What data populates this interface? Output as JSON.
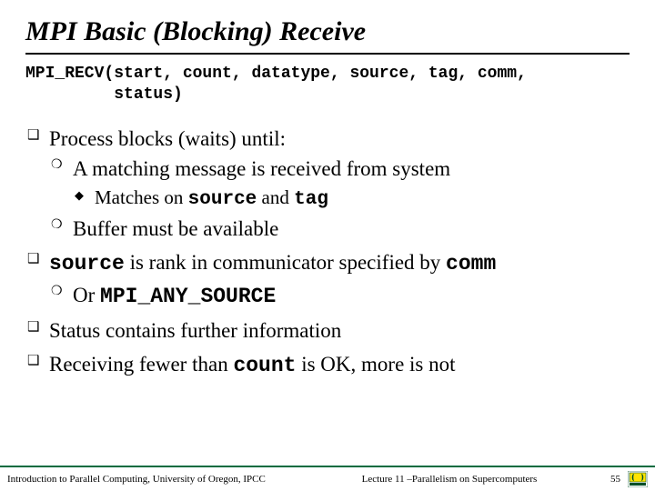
{
  "title": "MPI Basic (Blocking) Receive",
  "signature": "MPI_RECV(start, count, datatype, source, tag, comm,\n         status)",
  "bullets": {
    "b1": "Process blocks (waits) until:",
    "b1a_pre": "A matching message is received from system",
    "b1a1_pre": "Matches on ",
    "b1a1_m1": "source",
    "b1a1_mid": " and ",
    "b1a1_m2": "tag",
    "b1b": "Buffer must be available",
    "b2_m1": "source",
    "b2_mid": " is rank in communicator specified by ",
    "b2_m2": "comm",
    "b2a_pre": "Or ",
    "b2a_m": "MPI_ANY_SOURCE",
    "b3": "Status contains further information",
    "b4_pre": "Receiving fewer than ",
    "b4_m": "count",
    "b4_post": " is OK, more is not"
  },
  "footer": {
    "left": "Introduction to Parallel Computing, University of Oregon, IPCC",
    "center": "Lecture 11 –Parallelism on Supercomputers",
    "page": "55"
  }
}
